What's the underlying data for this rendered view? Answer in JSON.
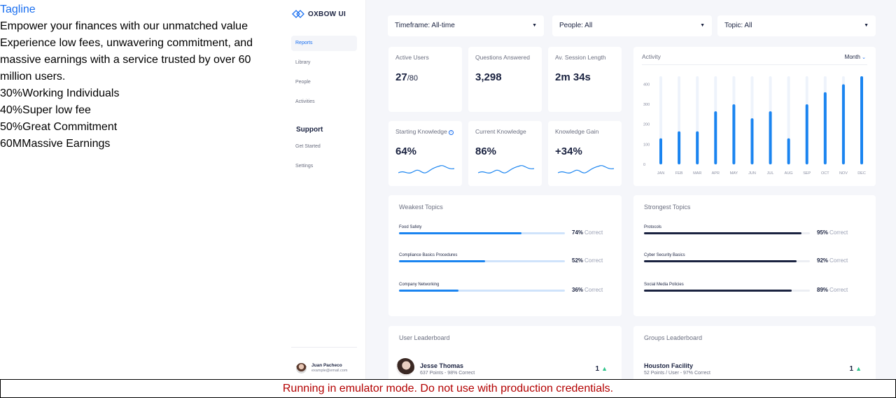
{
  "marketing": {
    "tagline": "Tagline",
    "headline": "Empower your finances with our unmatched value",
    "description": "Experience low fees, unwavering commitment, and massive earnings with a service trusted by over 60 million users.",
    "stats": [
      {
        "value": "30%",
        "label": "Working Individuals"
      },
      {
        "value": "40%",
        "label": "Super low fee"
      },
      {
        "value": "50%",
        "label": "Great Commitment"
      },
      {
        "value": "60M",
        "label": "Massive Earnings"
      }
    ]
  },
  "sidebar": {
    "brand": "OXBOW UI",
    "items": [
      {
        "label": "Reports",
        "active": true
      },
      {
        "label": "Library"
      },
      {
        "label": "People"
      },
      {
        "label": "Activities"
      }
    ],
    "support_heading": "Support",
    "support_items": [
      {
        "label": "Get Started"
      },
      {
        "label": "Settings"
      }
    ],
    "user": {
      "name": "Juan Pacheco",
      "email": "example@email.com"
    }
  },
  "filters": [
    {
      "label": "Timeframe: All-time"
    },
    {
      "label": "People: All"
    },
    {
      "label": "Topic: All"
    }
  ],
  "stats": [
    {
      "label": "Active Users",
      "value": "27",
      "sub": "/80"
    },
    {
      "label": "Questions Answered",
      "value": "3,298"
    },
    {
      "label": "Av. Session Length",
      "value": "2m 34s"
    },
    {
      "label": "Starting Knowledge",
      "value": "64%"
    },
    {
      "label": "Current Knowledge",
      "value": "86%"
    },
    {
      "label": "Knowledge Gain",
      "value": "+34%"
    }
  ],
  "activity": {
    "title": "Activity",
    "period": "Month",
    "accent": "#1a84f0",
    "track": "#eef3fb"
  },
  "chart_data": {
    "type": "bar",
    "title": "Activity",
    "categories": [
      "JAN",
      "FEB",
      "MAR",
      "APR",
      "MAY",
      "JUN",
      "JUL",
      "AUG",
      "SEP",
      "OCT",
      "NOV",
      "DEC"
    ],
    "values": [
      130,
      165,
      165,
      265,
      300,
      230,
      265,
      130,
      300,
      360,
      400,
      440
    ],
    "ylim": [
      0,
      440
    ],
    "yticks": [
      0,
      100,
      200,
      300,
      400
    ],
    "xlabel": "",
    "ylabel": "",
    "grid": false
  },
  "weakest": {
    "title": "Weakest Topics",
    "fill_color": "#1a84f0",
    "track_color": "#cfe3fb",
    "correct_label": "Correct",
    "items": [
      {
        "name": "Food Safety",
        "pct": 74,
        "pct_label": "74%"
      },
      {
        "name": "Compliance Basics Procedures",
        "pct": 52,
        "pct_label": "52%"
      },
      {
        "name": "Company Networking",
        "pct": 36,
        "pct_label": "36%"
      }
    ]
  },
  "strongest": {
    "title": "Strongest Topics",
    "fill_color": "#1a2240",
    "track_color": "#eceef3",
    "correct_label": "Correct",
    "items": [
      {
        "name": "Protocols",
        "pct": 95,
        "pct_label": "95%"
      },
      {
        "name": "Cyber Security Basics",
        "pct": 92,
        "pct_label": "92%"
      },
      {
        "name": "Social Media Policies",
        "pct": 89,
        "pct_label": "89%"
      }
    ]
  },
  "user_leaderboard": {
    "title": "User Leaderboard",
    "rows": [
      {
        "name": "Jesse Thomas",
        "meta": "637 Points - 98% Correct",
        "rank": "1"
      }
    ]
  },
  "groups_leaderboard": {
    "title": "Groups Leaderboard",
    "rows": [
      {
        "name": "Houston Facility",
        "meta": "52 Points / User - 97% Correct",
        "rank": "1"
      }
    ]
  },
  "banner": "Running in emulator mode. Do not use with production credentials."
}
